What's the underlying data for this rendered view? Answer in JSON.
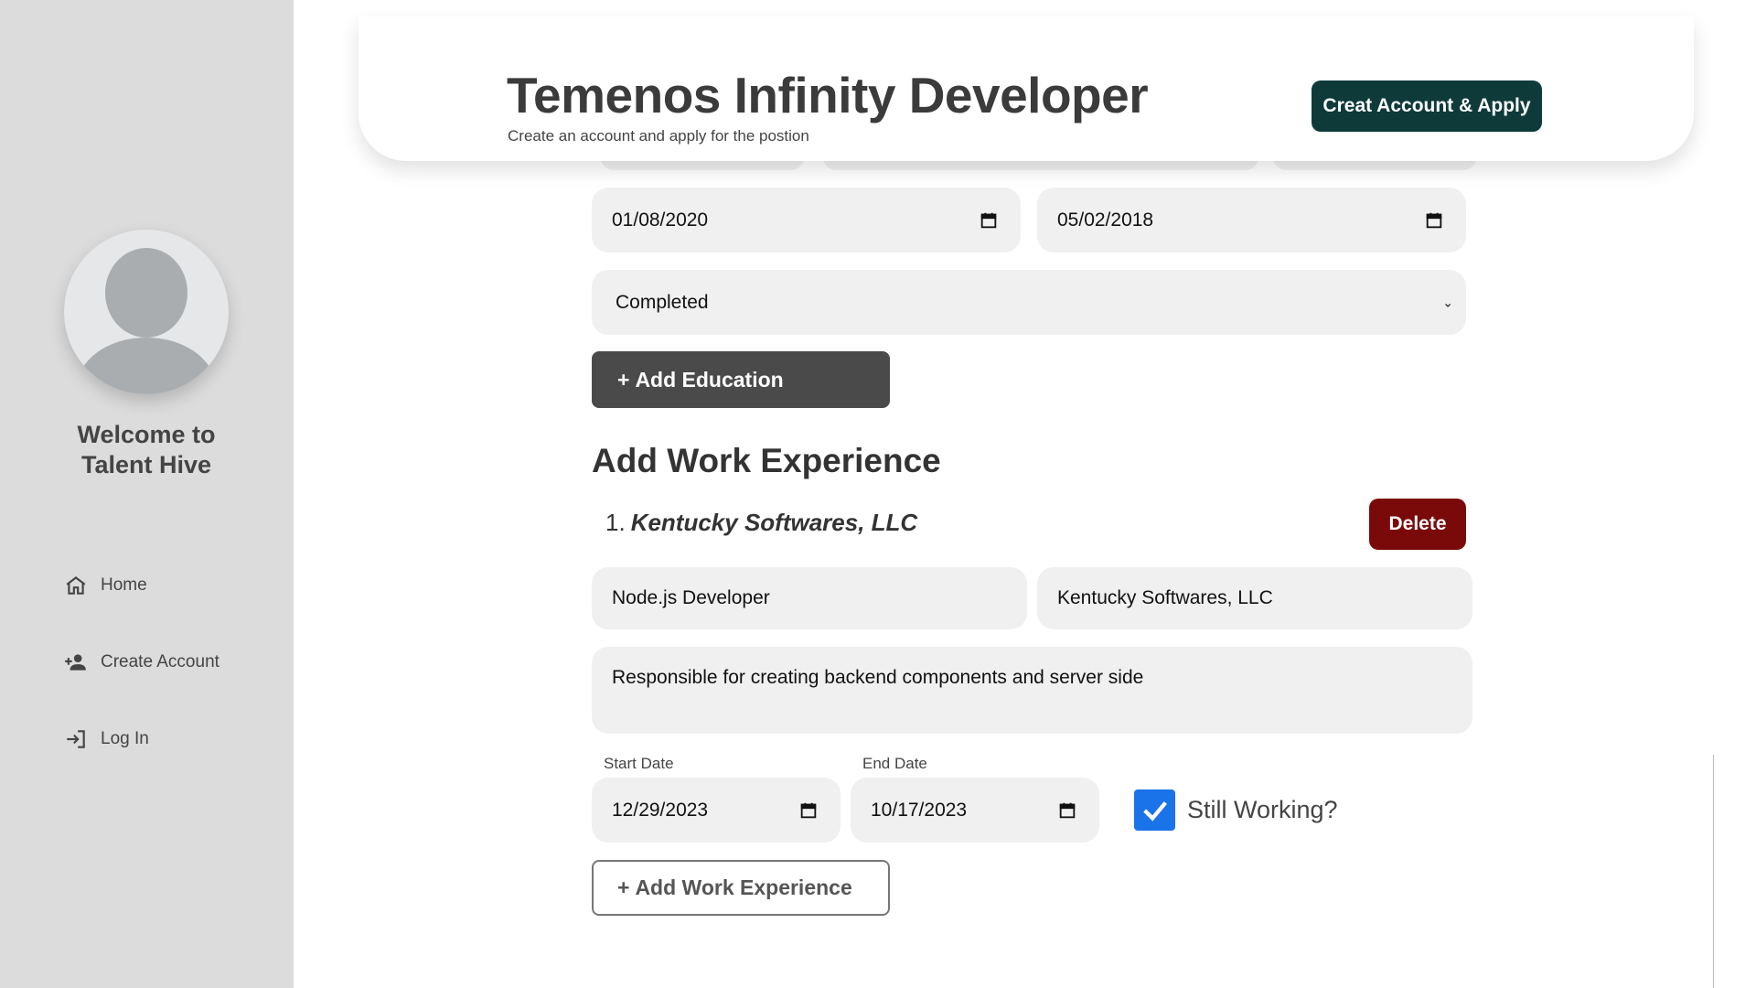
{
  "sidebar": {
    "welcome_line1": "Welcome to",
    "welcome_line2": "Talent Hive",
    "nav": [
      {
        "label": "Home",
        "icon": "home-icon"
      },
      {
        "label": "Create Account",
        "icon": "person-add-icon"
      },
      {
        "label": "Log In",
        "icon": "login-icon"
      }
    ]
  },
  "header": {
    "title": "Temenos Infinity Developer",
    "subtitle": "Create an account and apply for the postion",
    "apply_button": "Creat Account & Apply"
  },
  "education": {
    "start_date": "01/08/2020",
    "end_date": "05/02/2018",
    "status": "Completed",
    "add_button": "Add Education"
  },
  "work": {
    "section_title": "Add Work Experience",
    "entries": [
      {
        "number": "1.",
        "company_heading": "Kentucky Softwares, LLC",
        "delete_label": "Delete",
        "job_title": "Node.js Developer",
        "company": "Kentucky Softwares, LLC",
        "description": "Responsible for creating backend components and server side",
        "start_label": "Start Date",
        "start_date": "12/29/2023",
        "end_label": "End Date",
        "end_date": "10/17/2023",
        "still_working_label": "Still Working?",
        "still_working": true
      }
    ],
    "add_button": "Add Work Experience"
  },
  "colors": {
    "sidebar_bg": "#dcdcdc",
    "primary_button": "#0e3a3a",
    "delete_button": "#7a0a0a",
    "checkbox": "#1a73e8"
  }
}
